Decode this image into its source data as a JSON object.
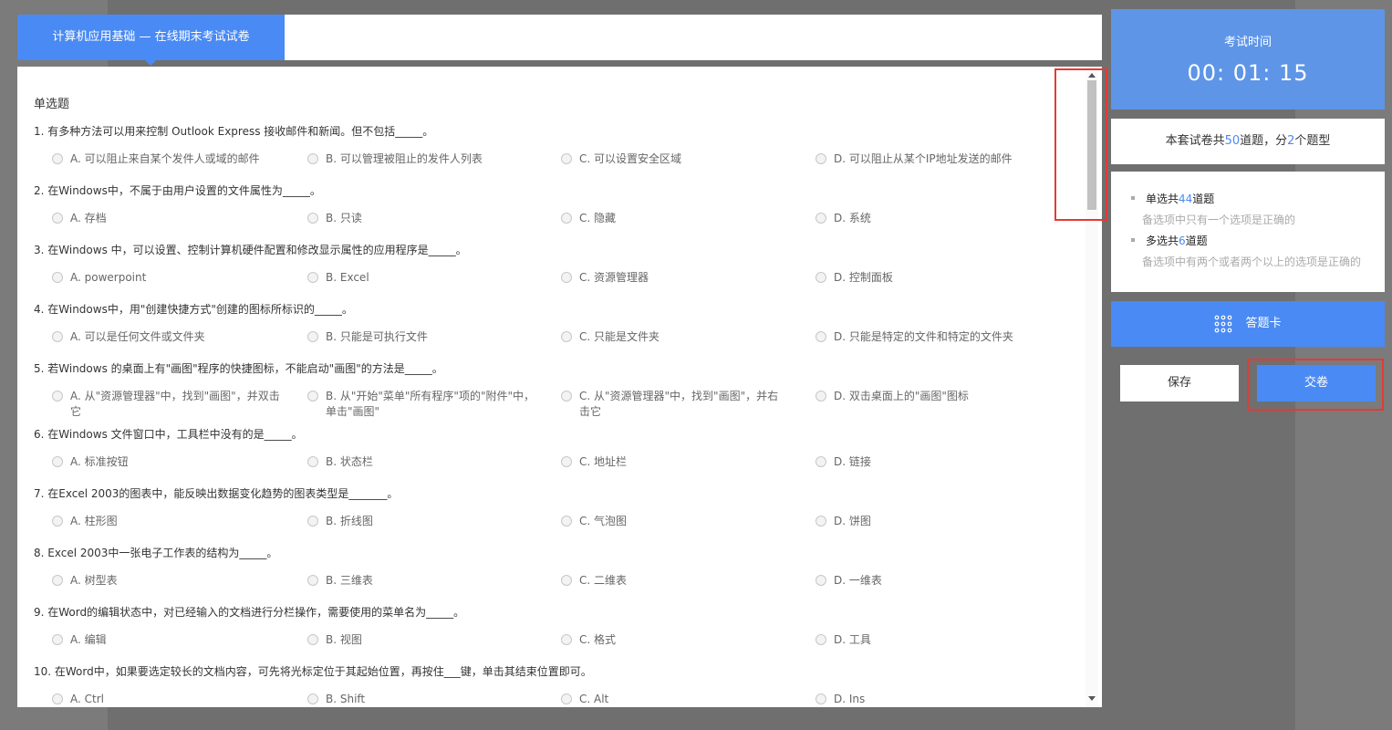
{
  "header": {
    "title": "计算机应用基础 — 在线期末考试试卷"
  },
  "section": {
    "title": "单选题"
  },
  "questions": [
    {
      "stem": "1. 有多种方法可以用来控制 Outlook Express 接收邮件和新闻。但不包括_____。",
      "options": [
        "A. 可以阻止来自某个发件人或域的邮件",
        "B. 可以管理被阻止的发件人列表",
        "C. 可以设置安全区域",
        "D. 可以阻止从某个IP地址发送的邮件"
      ]
    },
    {
      "stem": "2. 在Windows中，不属于由用户设置的文件属性为_____。",
      "options": [
        "A. 存档",
        "B. 只读",
        "C. 隐藏",
        "D. 系统"
      ]
    },
    {
      "stem": "3. 在Windows 中，可以设置、控制计算机硬件配置和修改显示属性的应用程序是_____。",
      "options": [
        "A. powerpoint",
        "B. Excel",
        "C. 资源管理器",
        "D. 控制面板"
      ]
    },
    {
      "stem": "4. 在Windows中，用\"创建快捷方式\"创建的图标所标识的_____。",
      "options": [
        "A. 可以是任何文件或文件夹",
        "B. 只能是可执行文件",
        "C. 只能是文件夹",
        "D. 只能是特定的文件和特定的文件夹"
      ]
    },
    {
      "stem": "5. 若Windows 的桌面上有\"画图\"程序的快捷图标，不能启动\"画图\"的方法是_____。",
      "options": [
        "A. 从\"资源管理器\"中，找到\"画图\"，并双击它",
        "B. 从\"开始\"菜单\"所有程序\"项的\"附件\"中，单击\"画图\"",
        "C. 从\"资源管理器\"中，找到\"画图\"，并右击它",
        "D. 双击桌面上的\"画图\"图标"
      ]
    },
    {
      "stem": "6. 在Windows 文件窗口中，工具栏中没有的是_____。",
      "options": [
        "A. 标准按钮",
        "B. 状态栏",
        "C. 地址栏",
        "D. 链接"
      ]
    },
    {
      "stem": "7. 在Excel 2003的图表中，能反映出数据变化趋势的图表类型是_______。",
      "options": [
        "A. 柱形图",
        "B. 折线图",
        "C. 气泡图",
        "D. 饼图"
      ]
    },
    {
      "stem": "8. Excel 2003中一张电子工作表的结构为_____。",
      "options": [
        "A. 树型表",
        "B. 三维表",
        "C. 二维表",
        "D. 一维表"
      ]
    },
    {
      "stem": "9. 在Word的编辑状态中，对已经输入的文档进行分栏操作，需要使用的菜单名为_____。",
      "options": [
        "A. 编辑",
        "B. 视图",
        "C. 格式",
        "D. 工具"
      ]
    },
    {
      "stem": "10. 在Word中，如果要选定较长的文档内容，可先将光标定位于其起始位置，再按住___键，单击其结束位置即可。",
      "options": [
        "A. Ctrl",
        "B. Shift",
        "C. Alt",
        "D. Ins"
      ]
    }
  ],
  "timer": {
    "label": "考试时间",
    "value": "00: 01: 15"
  },
  "summary": {
    "prefix": "本套试卷共",
    "total": "50",
    "middle": "道题，分",
    "types": "2",
    "suffix": "个题型"
  },
  "types": [
    {
      "prefix": "单选共",
      "count": "44",
      "suffix": "道题",
      "desc": "备选项中只有一个选项是正确的"
    },
    {
      "prefix": "多选共",
      "count": "6",
      "suffix": "道题",
      "desc": "备选项中有两个或者两个以上的选项是正确的"
    }
  ],
  "buttons": {
    "answer_card": "答题卡",
    "save": "保存",
    "submit": "交卷"
  },
  "colors": {
    "accent": "#4a8af4",
    "timer_bg": "#5e95e7",
    "highlight": "#e53935"
  }
}
